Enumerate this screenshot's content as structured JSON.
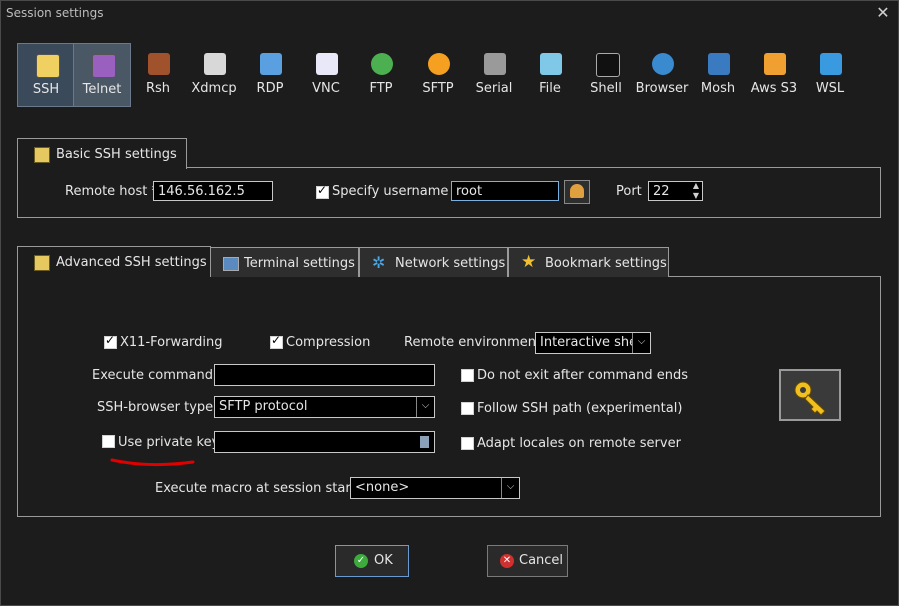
{
  "window": {
    "title": "Session settings"
  },
  "protocols": [
    {
      "label": "SSH",
      "icon": "ssh-icon"
    },
    {
      "label": "Telnet",
      "icon": "telnet-icon"
    },
    {
      "label": "Rsh",
      "icon": "rsh-icon"
    },
    {
      "label": "Xdmcp",
      "icon": "xdmcp-icon"
    },
    {
      "label": "RDP",
      "icon": "rdp-icon"
    },
    {
      "label": "VNC",
      "icon": "vnc-icon"
    },
    {
      "label": "FTP",
      "icon": "ftp-icon"
    },
    {
      "label": "SFTP",
      "icon": "sftp-icon"
    },
    {
      "label": "Serial",
      "icon": "serial-icon"
    },
    {
      "label": "File",
      "icon": "file-icon"
    },
    {
      "label": "Shell",
      "icon": "shell-icon"
    },
    {
      "label": "Browser",
      "icon": "browser-icon"
    },
    {
      "label": "Mosh",
      "icon": "mosh-icon"
    },
    {
      "label": "Aws S3",
      "icon": "aws-s3-icon"
    },
    {
      "label": "WSL",
      "icon": "wsl-icon"
    }
  ],
  "basic": {
    "tab_label": "Basic SSH settings",
    "remote_host_label": "Remote host *",
    "remote_host_value": "146.56.162.5",
    "specify_username_label": "Specify username",
    "username_value": "root",
    "port_label": "Port",
    "port_value": "22"
  },
  "tabs": [
    {
      "label": "Advanced SSH settings"
    },
    {
      "label": "Terminal settings"
    },
    {
      "label": "Network settings"
    },
    {
      "label": "Bookmark settings"
    }
  ],
  "advanced": {
    "x11_label": "X11-Forwarding",
    "compression_label": "Compression",
    "remote_env_label": "Remote environment:",
    "remote_env_value": "Interactive shell",
    "exec_cmd_label": "Execute command:",
    "exec_cmd_value": "",
    "no_exit_label": "Do not exit after command ends",
    "browser_type_label": "SSH-browser type:",
    "browser_type_value": "SFTP protocol",
    "follow_path_label": "Follow SSH path (experimental)",
    "private_key_label": "Use private key",
    "private_key_value": "",
    "adapt_locales_label": "Adapt locales on remote server",
    "macro_label": "Execute macro at session start:",
    "macro_value": "<none>"
  },
  "buttons": {
    "ok": "OK",
    "cancel": "Cancel"
  },
  "colors": {
    "accent": "#e6c860",
    "annotation": "#e00000"
  }
}
